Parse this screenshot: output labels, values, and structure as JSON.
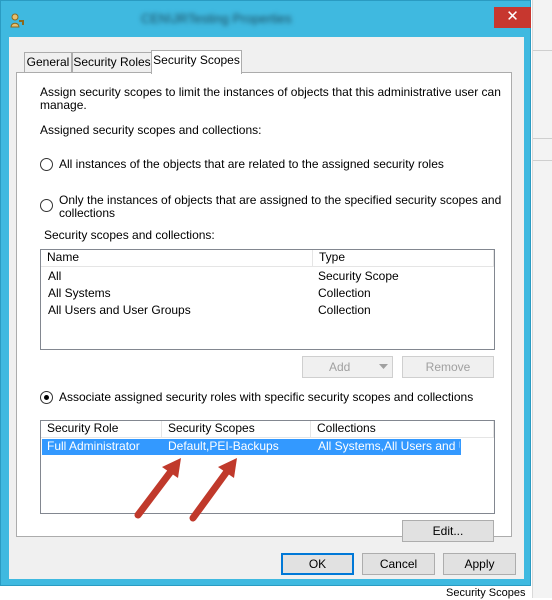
{
  "window": {
    "title": "CEN\\JRTesting Properties",
    "close_glyph": "✕"
  },
  "tabs": [
    {
      "label": "General"
    },
    {
      "label": "Security Roles"
    },
    {
      "label": "Security Scopes"
    }
  ],
  "active_tab": "Security Scopes",
  "panel": {
    "intro_line1": "Assign security scopes to limit the instances of objects that  this administrative user can",
    "intro_line2": "manage.",
    "assigned_label": "Assigned security scopes and collections:",
    "radio_all": "All instances of the objects that are related to the assigned security roles",
    "radio_only_line1": "Only the instances of objects  that are assigned to the specified security scopes and",
    "radio_only_line2": "collections",
    "scopes_label": "Security scopes and collections:",
    "scopes_table": {
      "columns": [
        "Name",
        "Type"
      ],
      "rows": [
        [
          "All",
          "Security Scope"
        ],
        [
          "All Systems",
          "Collection"
        ],
        [
          "All Users and User Groups",
          "Collection"
        ]
      ]
    },
    "add_label": "Add",
    "remove_label": "Remove",
    "radio_associate": "Associate assigned security roles with specific security scopes and collections",
    "roles_table": {
      "columns": [
        "Security Role",
        "Security Scopes",
        "Collections"
      ],
      "rows": [
        [
          "Full Administrator",
          "Default,PEI-Backups",
          "All Systems,All Users and U..."
        ]
      ]
    },
    "edit_label": "Edit..."
  },
  "footer": {
    "ok_label": "OK",
    "cancel_label": "Cancel",
    "apply_label": "Apply"
  },
  "background": {
    "bottom_text": "Security Scopes"
  },
  "colors": {
    "titlebar": "#3fb9e0",
    "close": "#c7372f",
    "selection": "#3399ff",
    "arrow": "#c0392b"
  }
}
